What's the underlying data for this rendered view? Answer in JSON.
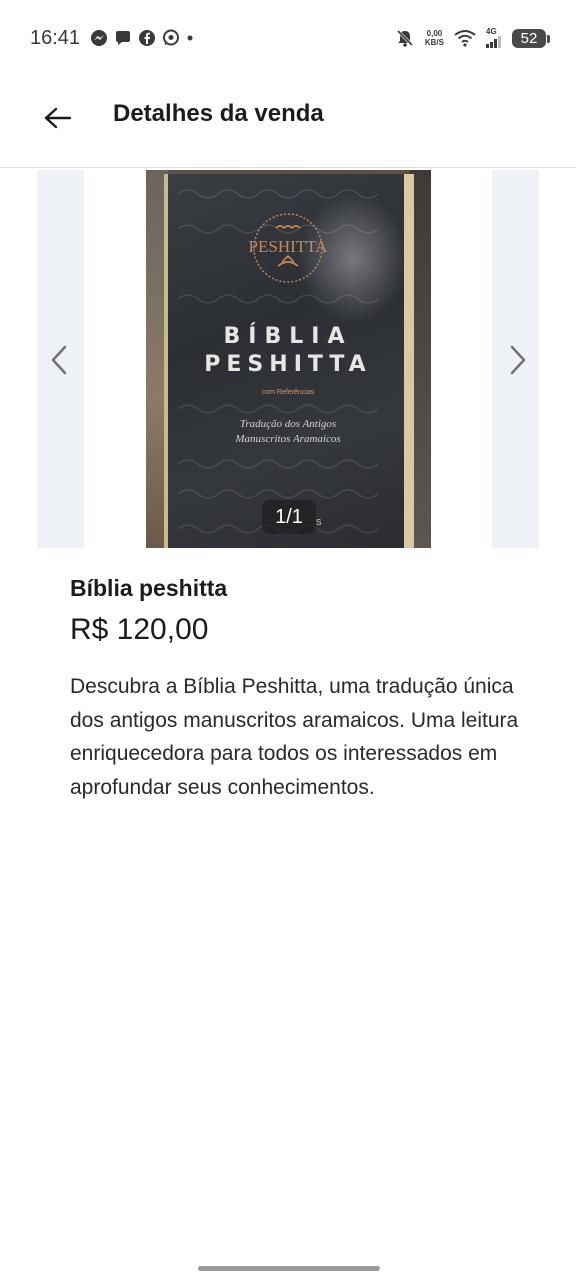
{
  "status_bar": {
    "time": "16:41",
    "notification_icons": [
      "messenger-icon",
      "chat-icon",
      "facebook-icon",
      "whatsapp-icon",
      "dot-icon"
    ],
    "speed_value": "0,00",
    "speed_unit": "KB/S",
    "network": "4G",
    "battery": "52"
  },
  "app_bar": {
    "title": "Detalhes da venda",
    "back_icon": "arrow-left-icon"
  },
  "gallery": {
    "counter": "1/1",
    "prev_icon": "chevron-left-icon",
    "next_icon": "chevron-right-icon",
    "photo_text": {
      "emblem_word": "PESHITTA",
      "title_line1": "BÍBLIA",
      "title_line2": "PESHITTA",
      "subtitle": "com Referências",
      "tagline_line1": "Tradução dos Antigos",
      "tagline_line2": "Manuscritos Aramaicos",
      "footer": "s"
    }
  },
  "product": {
    "title": "Bíblia peshitta",
    "price": "R$ 120,00",
    "description": "Descubra a Bíblia Peshitta, uma tradução única dos antigos manuscritos aramaicos. Uma leitura enriquecedora para todos os interessados em aprofundar seus conhecimentos."
  },
  "colors": {
    "text_primary": "#1c1c1c",
    "divider": "#dcdcdc",
    "side_panel": "#eef1f5",
    "counter_bg": "#1e1e1e"
  }
}
